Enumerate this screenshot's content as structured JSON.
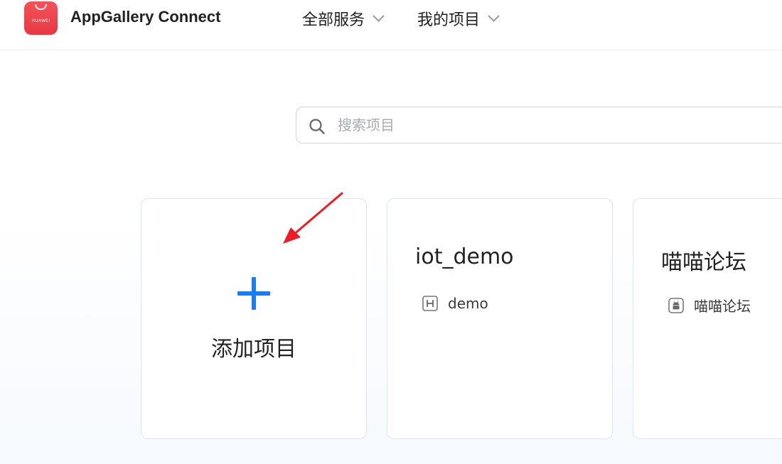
{
  "header": {
    "logo_brand": "HUAWEI",
    "app_title": "AppGallery Connect",
    "nav": [
      {
        "label": "全部服务"
      },
      {
        "label": "我的项目"
      }
    ]
  },
  "search": {
    "placeholder": "搜索项目",
    "value": ""
  },
  "cards": {
    "add": {
      "label": "添加项目"
    },
    "projects": [
      {
        "name": "iot_demo",
        "app": {
          "name": "demo",
          "icon": "harmony-h-icon"
        }
      },
      {
        "name": "喵喵论坛",
        "app": {
          "name": "喵喵论坛",
          "icon": "android-icon"
        }
      }
    ]
  },
  "colors": {
    "brand_red": "#e83843",
    "accent_blue": "#1a7ef2",
    "annotation_red": "#ee1c25"
  }
}
